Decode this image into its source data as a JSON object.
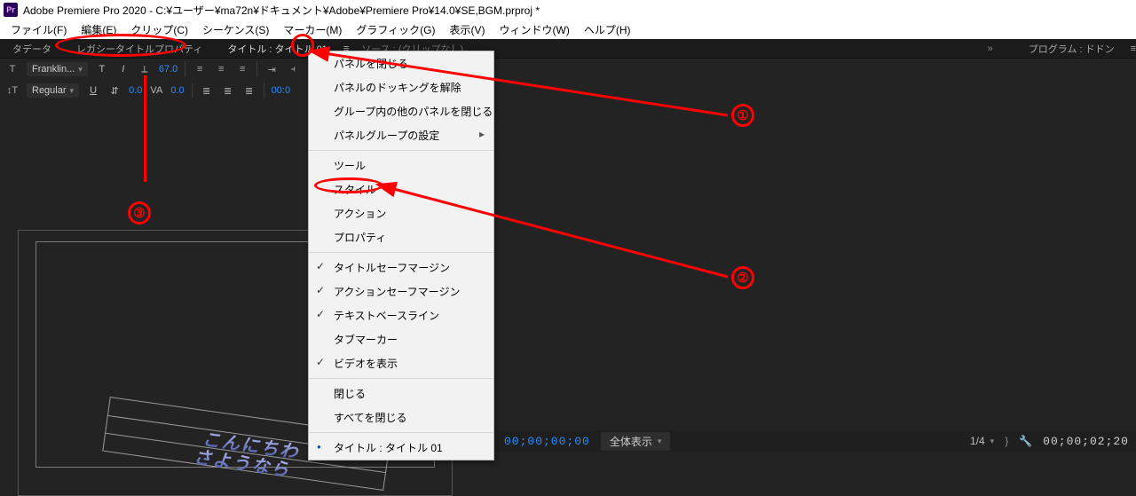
{
  "titlebar": {
    "app_badge": "Pr",
    "title": "Adobe Premiere Pro 2020 - C:¥ユーザー¥ma72n¥ドキュメント¥Adobe¥Premiere Pro¥14.0¥SE,BGM.prproj *"
  },
  "menubar": {
    "file": "ファイル(F)",
    "edit": "編集(E)",
    "clip": "クリップ(C)",
    "sequence": "シーケンス(S)",
    "marker": "マーカー(M)",
    "graphic": "グラフィック(G)",
    "view": "表示(V)",
    "window": "ウィンドウ(W)",
    "help": "ヘルプ(H)"
  },
  "tabs": {
    "data": "タデータ",
    "legacy_title_props": "レガシータイトルプロパティ",
    "title_panel": "タイトル : タイトル 01",
    "source": "ソース : (クリップなし)",
    "program": "プログラム : ドドン"
  },
  "tool": {
    "font_family": "Franklin...",
    "font_style": "Regular",
    "font_size": "67.0",
    "leading": "0.0",
    "kerning": "0.0",
    "tracking": "00:0"
  },
  "context_menu": {
    "close_panel": "パネルを閉じる",
    "undock_panel": "パネルのドッキングを解除",
    "close_others": "グループ内の他のパネルを閉じる",
    "panel_group_settings": "パネルグループの設定",
    "tool": "ツール",
    "style": "スタイル",
    "action": "アクション",
    "property": "プロパティ",
    "title_safe": "タイトルセーフマージン",
    "action_safe": "アクションセーフマージン",
    "text_baseline": "テキストベースライン",
    "tab_marker": "タブマーカー",
    "show_video": "ビデオを表示",
    "close": "閉じる",
    "close_all": "すべてを閉じる",
    "title_entry": "タイトル : タイトル 01"
  },
  "canvas_text": {
    "line1": "こんにちわ",
    "line2": "さようなら"
  },
  "timebar": {
    "timecode_left": "00;00;00;00",
    "fit": "全体表示",
    "fraction": "1/4",
    "timecode_right": "00;00;02;20"
  },
  "annotations": {
    "n1": "①",
    "n2": "②",
    "n3": "③"
  }
}
